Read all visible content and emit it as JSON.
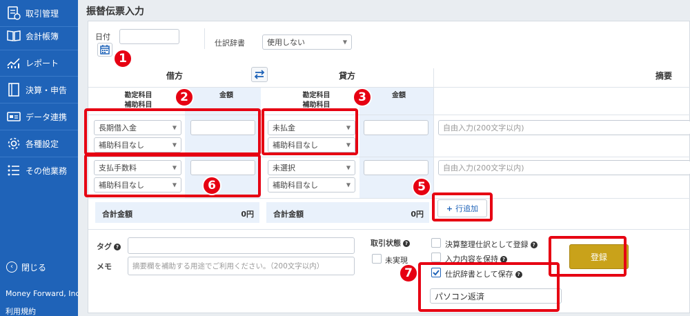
{
  "sidebar": {
    "items": [
      {
        "label": "取引管理",
        "icon": "transactions-icon"
      },
      {
        "label": "会計帳簿",
        "icon": "ledger-book-icon"
      },
      {
        "label": "レポート",
        "icon": "report-chart-icon"
      },
      {
        "label": "決算・申告",
        "icon": "settlement-icon"
      },
      {
        "label": "データ連携",
        "icon": "data-link-icon"
      },
      {
        "label": "各種設定",
        "icon": "gear-icon"
      },
      {
        "label": "その他業務",
        "icon": "list-icon"
      }
    ],
    "close_label": "閉じる",
    "company": "Money Forward, Inc.",
    "terms": "利用規約"
  },
  "page": {
    "title": "振替伝票入力"
  },
  "form": {
    "date_label": "日付",
    "date_value": "",
    "journal_dict_label": "仕訳辞書",
    "journal_dict_value": "使用しない"
  },
  "headers": {
    "debit": "借方",
    "credit": "貸方",
    "memo_col": "摘要",
    "account_line1": "勘定科目",
    "account_line2": "補助科目",
    "amount": "金額"
  },
  "rows": [
    {
      "debit_account": "長期借入金",
      "debit_sub": "補助科目なし",
      "debit_amount": "",
      "credit_account": "未払金",
      "credit_sub": "補助科目なし",
      "credit_amount": "",
      "memo_placeholder": "自由入力(200文字以内)"
    },
    {
      "debit_account": "支払手数料",
      "debit_sub": "補助科目なし",
      "debit_amount": "",
      "credit_account": "未選択",
      "credit_sub": "補助科目なし",
      "credit_amount": "",
      "memo_placeholder": "自由入力(200文字以内)"
    }
  ],
  "totals": {
    "debit_label": "合計金額",
    "debit_value": "0円",
    "credit_label": "合計金額",
    "credit_value": "0円"
  },
  "add_row_label": "行追加",
  "tag_label": "タグ",
  "memo_label": "メモ",
  "memo_placeholder": "摘要欄を補助する用途でご利用ください。（200文字以内）",
  "status_label": "取引状態",
  "unrealized_label": "未実現",
  "settlement_label": "決算整理仕訳として登録",
  "keep_input_label": "入力内容を保持",
  "save_dict_label": "仕訳辞書として保存",
  "save_dict_checked": true,
  "dict_name_value": "パソコン返済",
  "register_label": "登録",
  "annotations": [
    "1",
    "2",
    "3",
    "5",
    "6",
    "7"
  ],
  "colors": {
    "sidebar": "#1f63b8",
    "register": "#c9a21a",
    "annotation": "#e60012"
  }
}
